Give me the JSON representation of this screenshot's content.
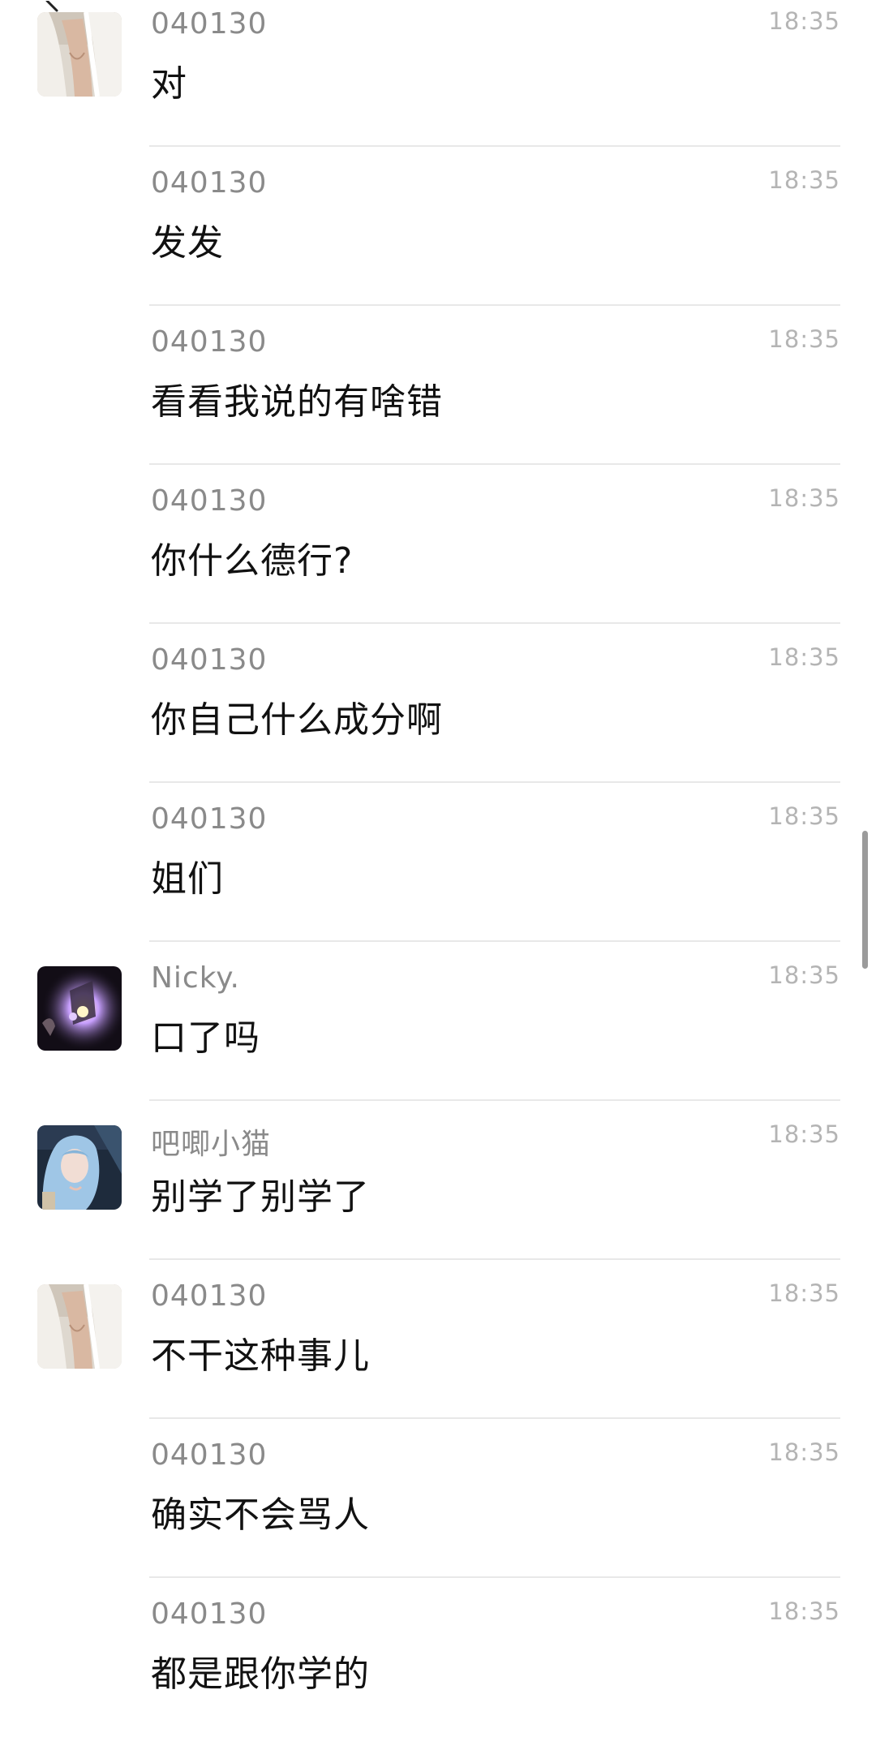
{
  "colors": {
    "background": "#ffffff",
    "sender_text": "#8a8a8a",
    "time_text": "#b4b4b4",
    "message_text": "#111111",
    "divider": "#e8e8e8",
    "scrollbar": "#9b9b9b"
  },
  "messages": [
    {
      "sender": "040130",
      "time": "18:35",
      "text": "对",
      "avatar": "white-dress-avatar"
    },
    {
      "sender": "040130",
      "time": "18:35",
      "text": "发发",
      "avatar": null
    },
    {
      "sender": "040130",
      "time": "18:35",
      "text": "看看我说的有啥错",
      "avatar": null
    },
    {
      "sender": "040130",
      "time": "18:35",
      "text": "你什么德行?",
      "avatar": null
    },
    {
      "sender": "040130",
      "time": "18:35",
      "text": "你自己什么成分啊",
      "avatar": null
    },
    {
      "sender": "040130",
      "time": "18:35",
      "text": "姐们",
      "avatar": null
    },
    {
      "sender": "Nicky.",
      "time": "18:35",
      "text": "口了吗",
      "avatar": "dark-glow-avatar"
    },
    {
      "sender": "吧唧小猫",
      "time": "18:35",
      "text": "别学了别学了",
      "avatar": "blue-hair-avatar"
    },
    {
      "sender": "040130",
      "time": "18:35",
      "text": "不干这种事儿",
      "avatar": "white-dress-avatar"
    },
    {
      "sender": "040130",
      "time": "18:35",
      "text": "确实不会骂人",
      "avatar": null
    },
    {
      "sender": "040130",
      "time": "18:35",
      "text": "都是跟你学的",
      "avatar": null
    }
  ]
}
